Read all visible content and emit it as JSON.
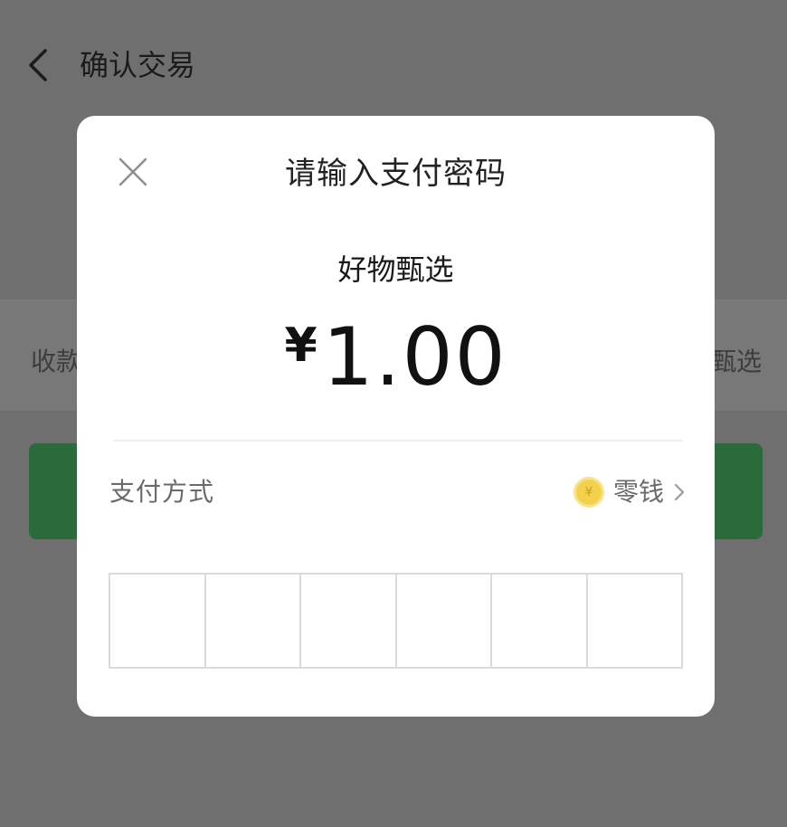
{
  "header": {
    "title": "确认交易"
  },
  "payee": {
    "label": "收款",
    "value": "甄选"
  },
  "modal": {
    "title": "请输入支付密码",
    "merchant": "好物甄选",
    "currency": "¥",
    "amount": "1.00",
    "payment_method_label": "支付方式",
    "payment_method_value": "零钱",
    "coin_glyph": "¥",
    "pin_cells": 6
  },
  "colors": {
    "overlay": "#6f6f6f",
    "confirm_button": "#2a6a3b",
    "coin": "#f3d14c",
    "modal_bg": "#ffffff"
  },
  "icons": [
    "back-arrow-icon",
    "close-icon",
    "coin-icon",
    "chevron-right-icon"
  ]
}
